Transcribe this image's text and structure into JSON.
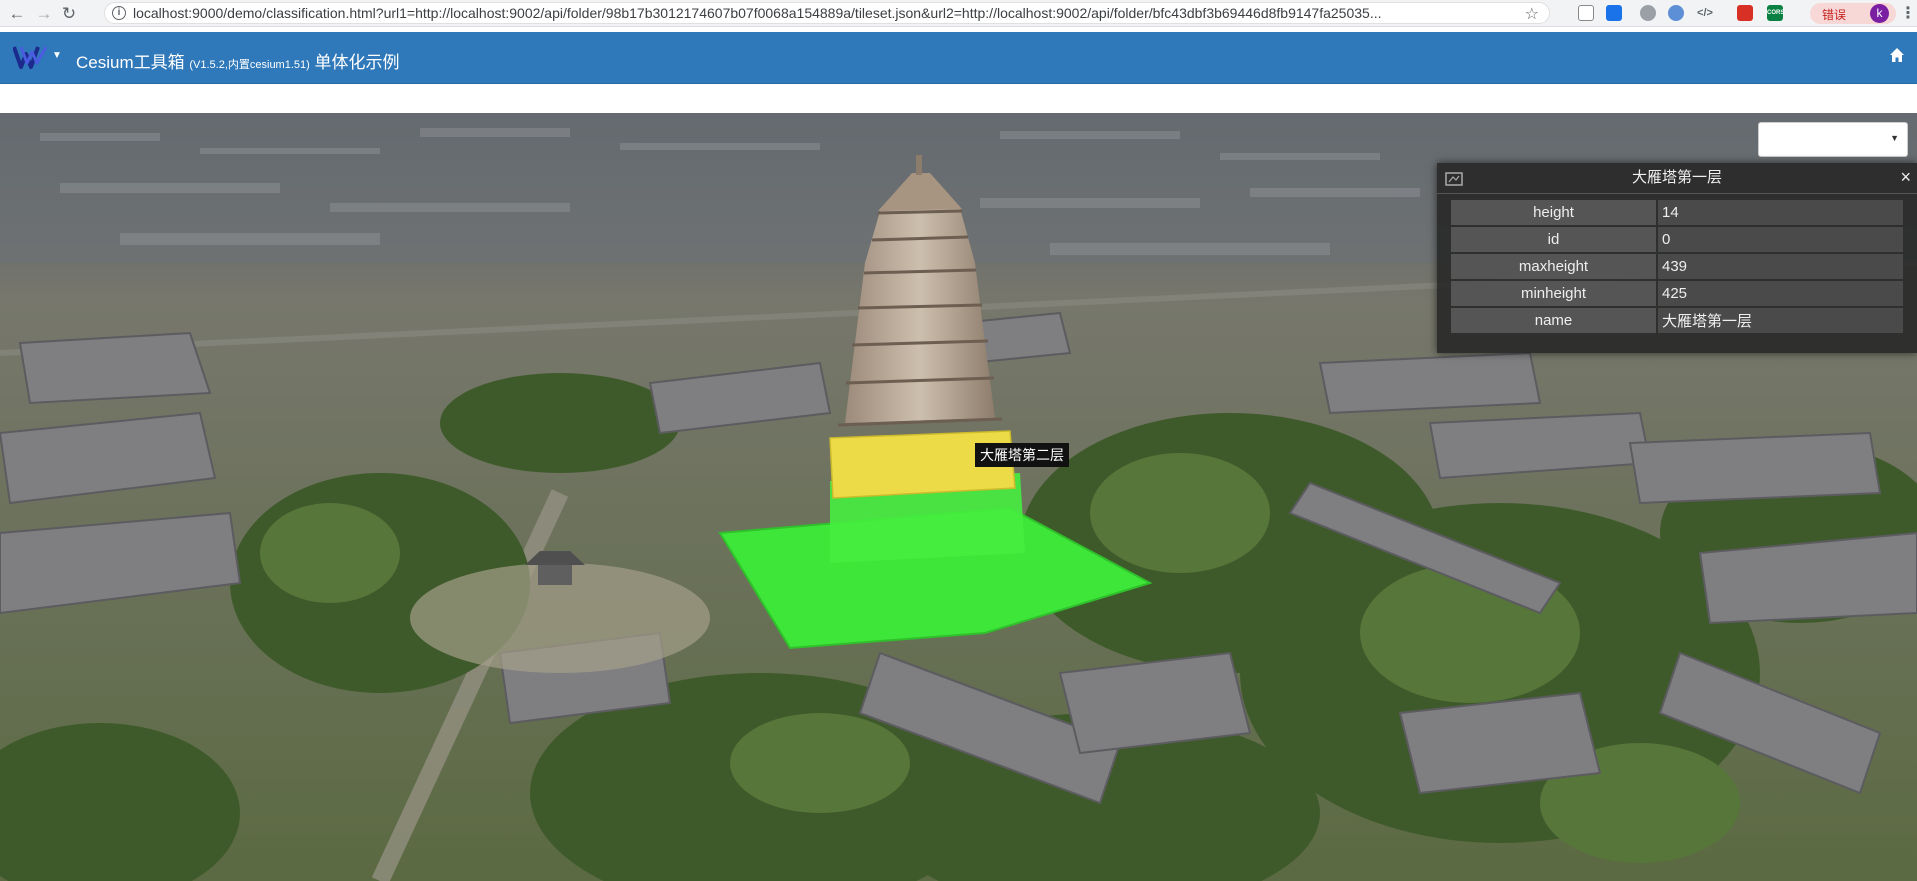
{
  "browser": {
    "url": "localhost:9000/demo/classification.html?url1=http://localhost:9002/api/folder/98b17b3012174607b07f0068a154889a/tileset.json&url2=http://localhost:9002/api/folder/bfc43dbf3b69446d8fb9147fa25035...",
    "error_label": "错误",
    "avatar_letter": "k",
    "extensions": [
      "shield-icon",
      "link-icon",
      "circle-icon",
      "compass-icon",
      "code-icon",
      "pdf-icon",
      "cors-icon"
    ],
    "cors_label": "CORS"
  },
  "header": {
    "title": "Cesium工具箱",
    "version": "(V1.5.2,内置cesium1.51)",
    "subtitle": "单体化示例",
    "accent_color": "#2f78b9"
  },
  "scene_select": {
    "value": ""
  },
  "infobox": {
    "title": "大雁塔第一层",
    "close_label": "×",
    "rows": [
      {
        "key": "height",
        "value": "14"
      },
      {
        "key": "id",
        "value": "0"
      },
      {
        "key": "maxheight",
        "value": "439"
      },
      {
        "key": "minheight",
        "value": "425"
      },
      {
        "key": "name",
        "value": "大雁塔第一层"
      }
    ]
  },
  "pick_label": "大雁塔第二层",
  "highlight_colors": {
    "floor1": "#3ee63a",
    "floor2": "#ecdb47"
  }
}
